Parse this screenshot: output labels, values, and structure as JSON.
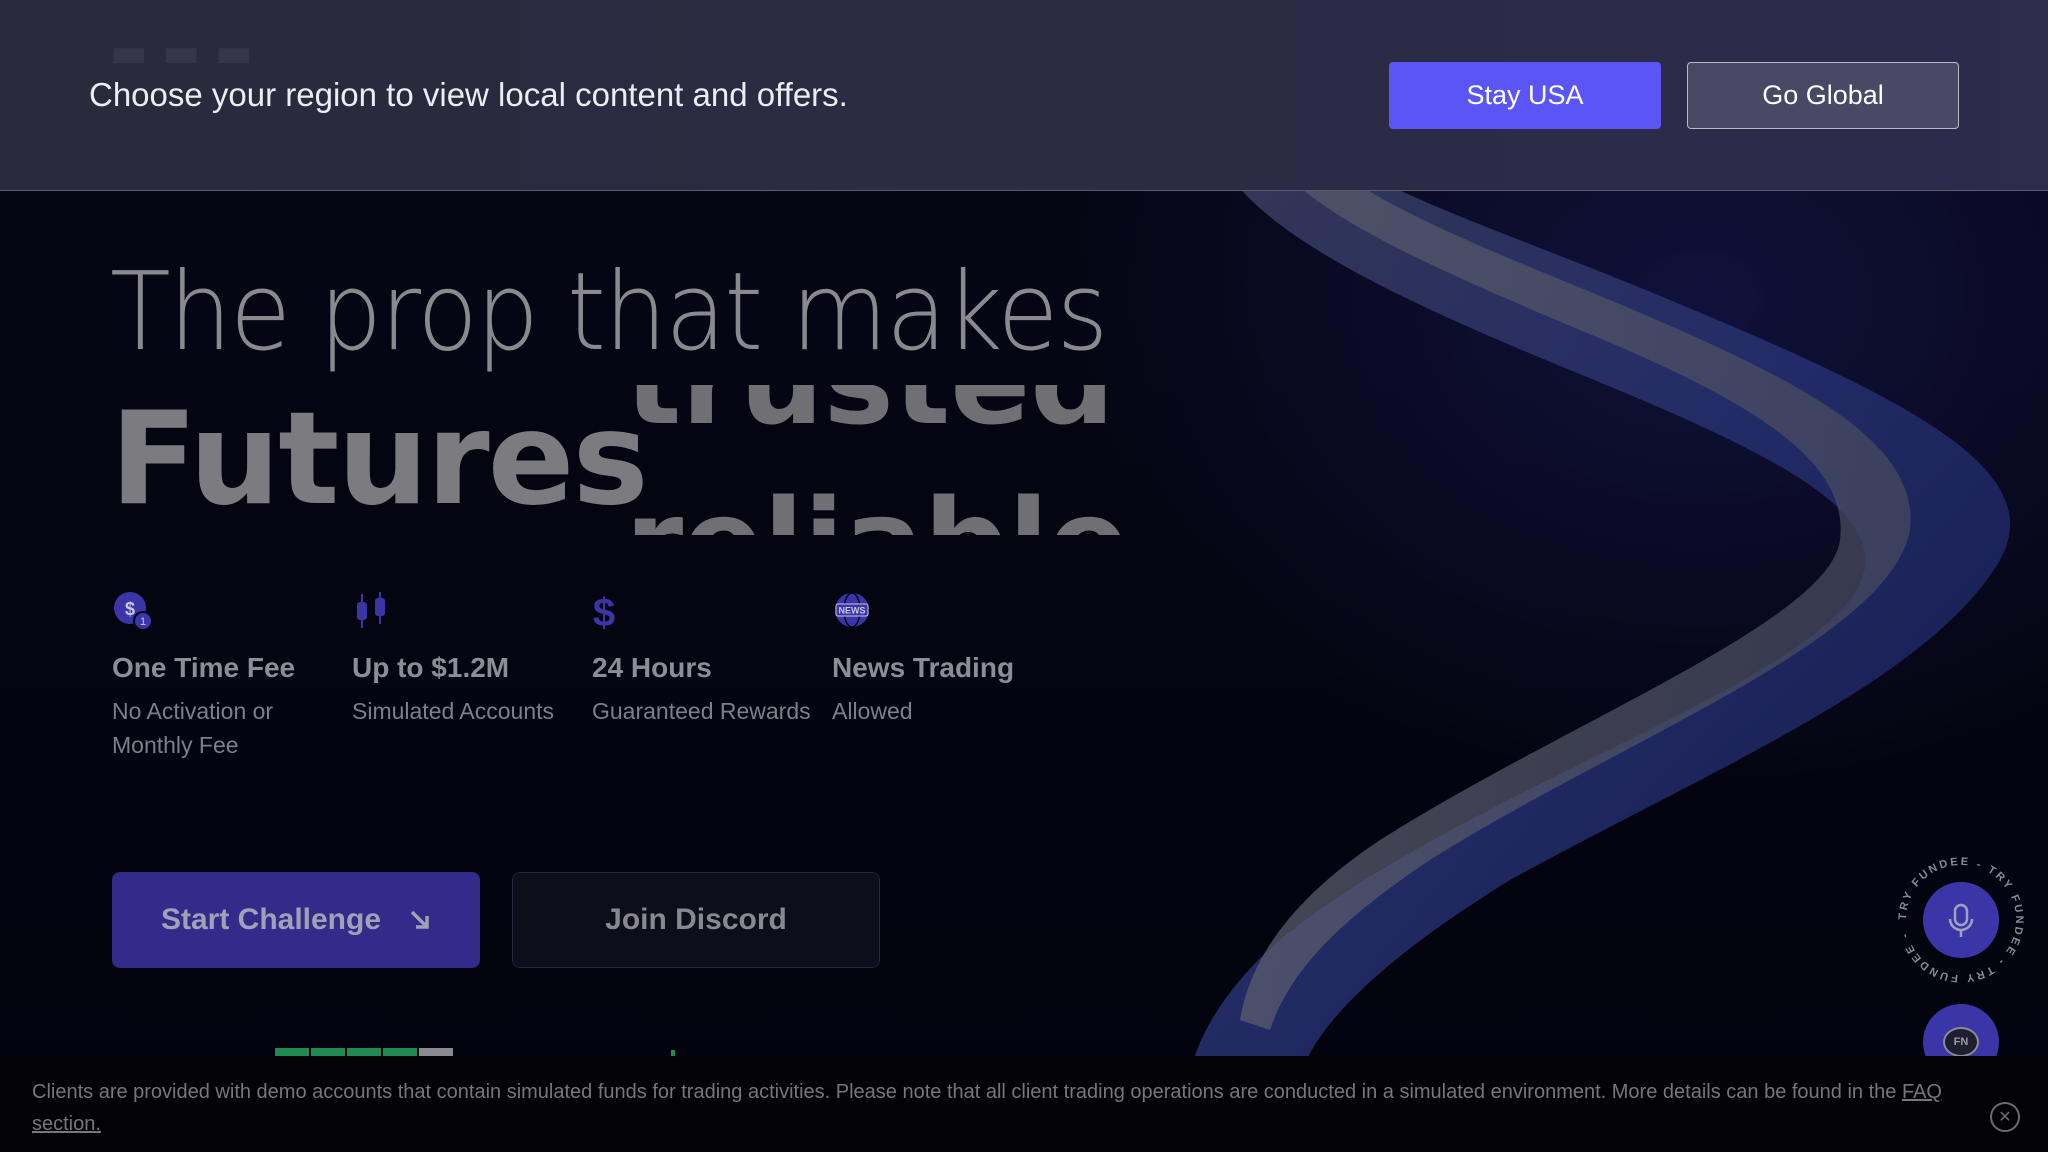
{
  "region_banner": {
    "message": "Choose your region to view local content and offers.",
    "stay_label": "Stay USA",
    "global_label": "Go Global",
    "stay_color": "#5b55f5"
  },
  "hero": {
    "line1": "The prop that makes",
    "highlight": "Futures",
    "rotating_words": [
      "trusted",
      "reliable"
    ]
  },
  "features": [
    {
      "icon": "coin-fee-icon",
      "title": "One Time Fee",
      "desc": "No Activation or Monthly Fee"
    },
    {
      "icon": "candlestick-icon",
      "title": "Up to $1.2M",
      "desc": "Simulated Accounts"
    },
    {
      "icon": "dollar-icon",
      "title": "24 Hours",
      "desc": "Guaranteed Rewards"
    },
    {
      "icon": "news-globe-icon",
      "title": "News Trading",
      "desc": "Allowed"
    }
  ],
  "cta": {
    "start_label": "Start Challenge",
    "discord_label": "Join Discord"
  },
  "widgets": {
    "voice_ring_text": "TRY FUNDEE - TRY FUNDEE - TRY FUNDEE - ",
    "chat_label": "FN"
  },
  "disclaimer": {
    "text": "Clients are provided with demo accounts that contain simulated funds for trading activities. Please note that all client trading operations are conducted in a simulated environment. More details can be found in the",
    "link_label": "FAQ section.",
    "close_icon": "close-icon"
  }
}
